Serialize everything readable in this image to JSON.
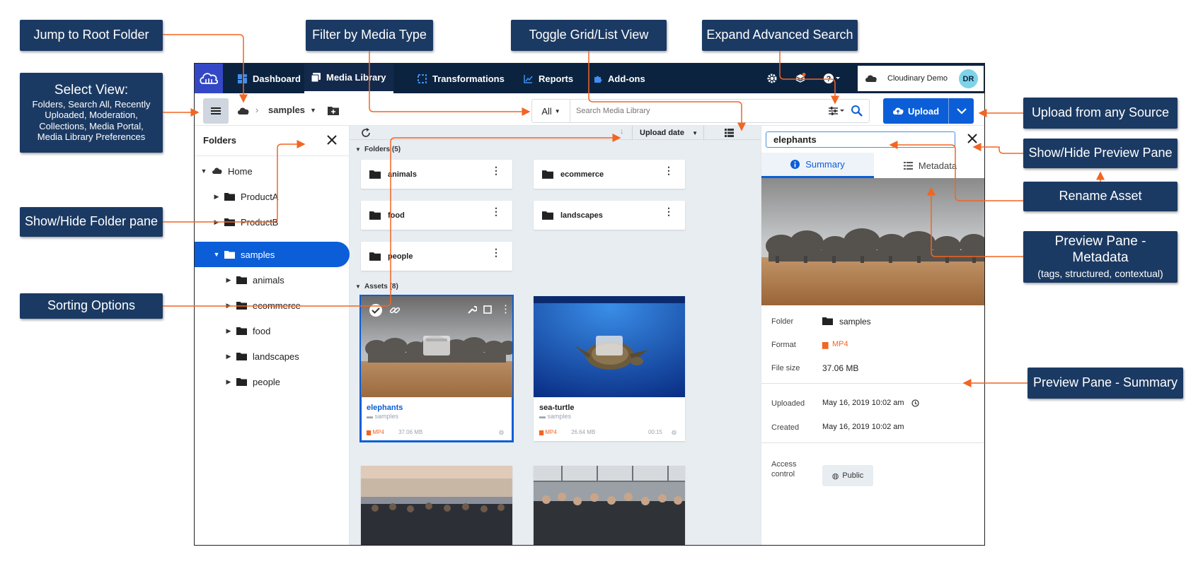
{
  "callouts": {
    "jump_root": "Jump to Root Folder",
    "filter_media": "Filter by Media Type",
    "toggle_view": "Toggle Grid/List View",
    "expand_search": "Expand Advanced Search",
    "select_view_title": "Select View:",
    "select_view_body": "Folders, Search All, Recently Uploaded, Moderation, Collections,  Media Portal, Media Library Preferences",
    "upload_source": "Upload from any Source",
    "show_hide_preview": "Show/Hide  Preview Pane",
    "rename_asset": "Rename Asset",
    "preview_metadata_title": "Preview Pane - Metadata",
    "preview_metadata_sub": "(tags, structured, contextual)",
    "show_hide_folder": "Show/Hide Folder pane",
    "sorting_options": "Sorting Options",
    "preview_summary": "Preview Pane - Summary"
  },
  "nav": {
    "items": [
      {
        "label": "Dashboard",
        "icon": "dashboard-icon"
      },
      {
        "label": "Media Library",
        "icon": "media-library-icon"
      },
      {
        "label": "Transformations",
        "icon": "transformations-icon"
      },
      {
        "label": "Reports",
        "icon": "reports-icon"
      },
      {
        "label": "Add-ons",
        "icon": "addons-icon"
      }
    ],
    "account_name": "Cloudinary Demo",
    "avatar_initials": "DR"
  },
  "toolbar": {
    "breadcrumb_folder": "samples",
    "search_type": "All",
    "search_placeholder": "Search Media Library",
    "upload_label": "Upload"
  },
  "folders_pane": {
    "title": "Folders",
    "tree": [
      {
        "label": "Home",
        "level": 0
      },
      {
        "label": "ProductA",
        "level": 1
      },
      {
        "label": "ProductB",
        "level": 1
      },
      {
        "label": "samples",
        "level": 1,
        "selected": true
      },
      {
        "label": "animals",
        "level": 2
      },
      {
        "label": "ecommerce",
        "level": 2
      },
      {
        "label": "food",
        "level": 2
      },
      {
        "label": "landscapes",
        "level": 2
      },
      {
        "label": "people",
        "level": 2
      }
    ]
  },
  "content": {
    "sort_label": "Upload date",
    "folders_heading": "Folders (5)",
    "folders": [
      "animals",
      "ecommerce",
      "food",
      "landscapes",
      "people"
    ],
    "assets_heading": "Assets (8)",
    "assets": [
      {
        "name": "elephants",
        "folder": "samples",
        "format": "MP4",
        "size": "37.06 MB",
        "duration": ""
      },
      {
        "name": "sea-turtle",
        "folder": "samples",
        "format": "MP4",
        "size": "26.64 MB",
        "duration": "00:15"
      }
    ]
  },
  "preview": {
    "asset_name": "elephants",
    "tab_summary": "Summary",
    "tab_metadata": "Metadata",
    "folder_label": "Folder",
    "folder_value": "samples",
    "format_label": "Format",
    "format_value": "MP4",
    "filesize_label": "File size",
    "filesize_value": "37.06 MB",
    "uploaded_label": "Uploaded",
    "uploaded_value": "May 16, 2019 10:02 am",
    "created_label": "Created",
    "created_value": "May 16, 2019 10:02 am",
    "access_label": "Access control",
    "access_value": "Public"
  },
  "colors": {
    "callout_bg": "#1b3a63",
    "arrow": "#f26522",
    "nav_bg": "#0c2340",
    "accent": "#0b5ed7",
    "format_orange": "#f26522"
  }
}
